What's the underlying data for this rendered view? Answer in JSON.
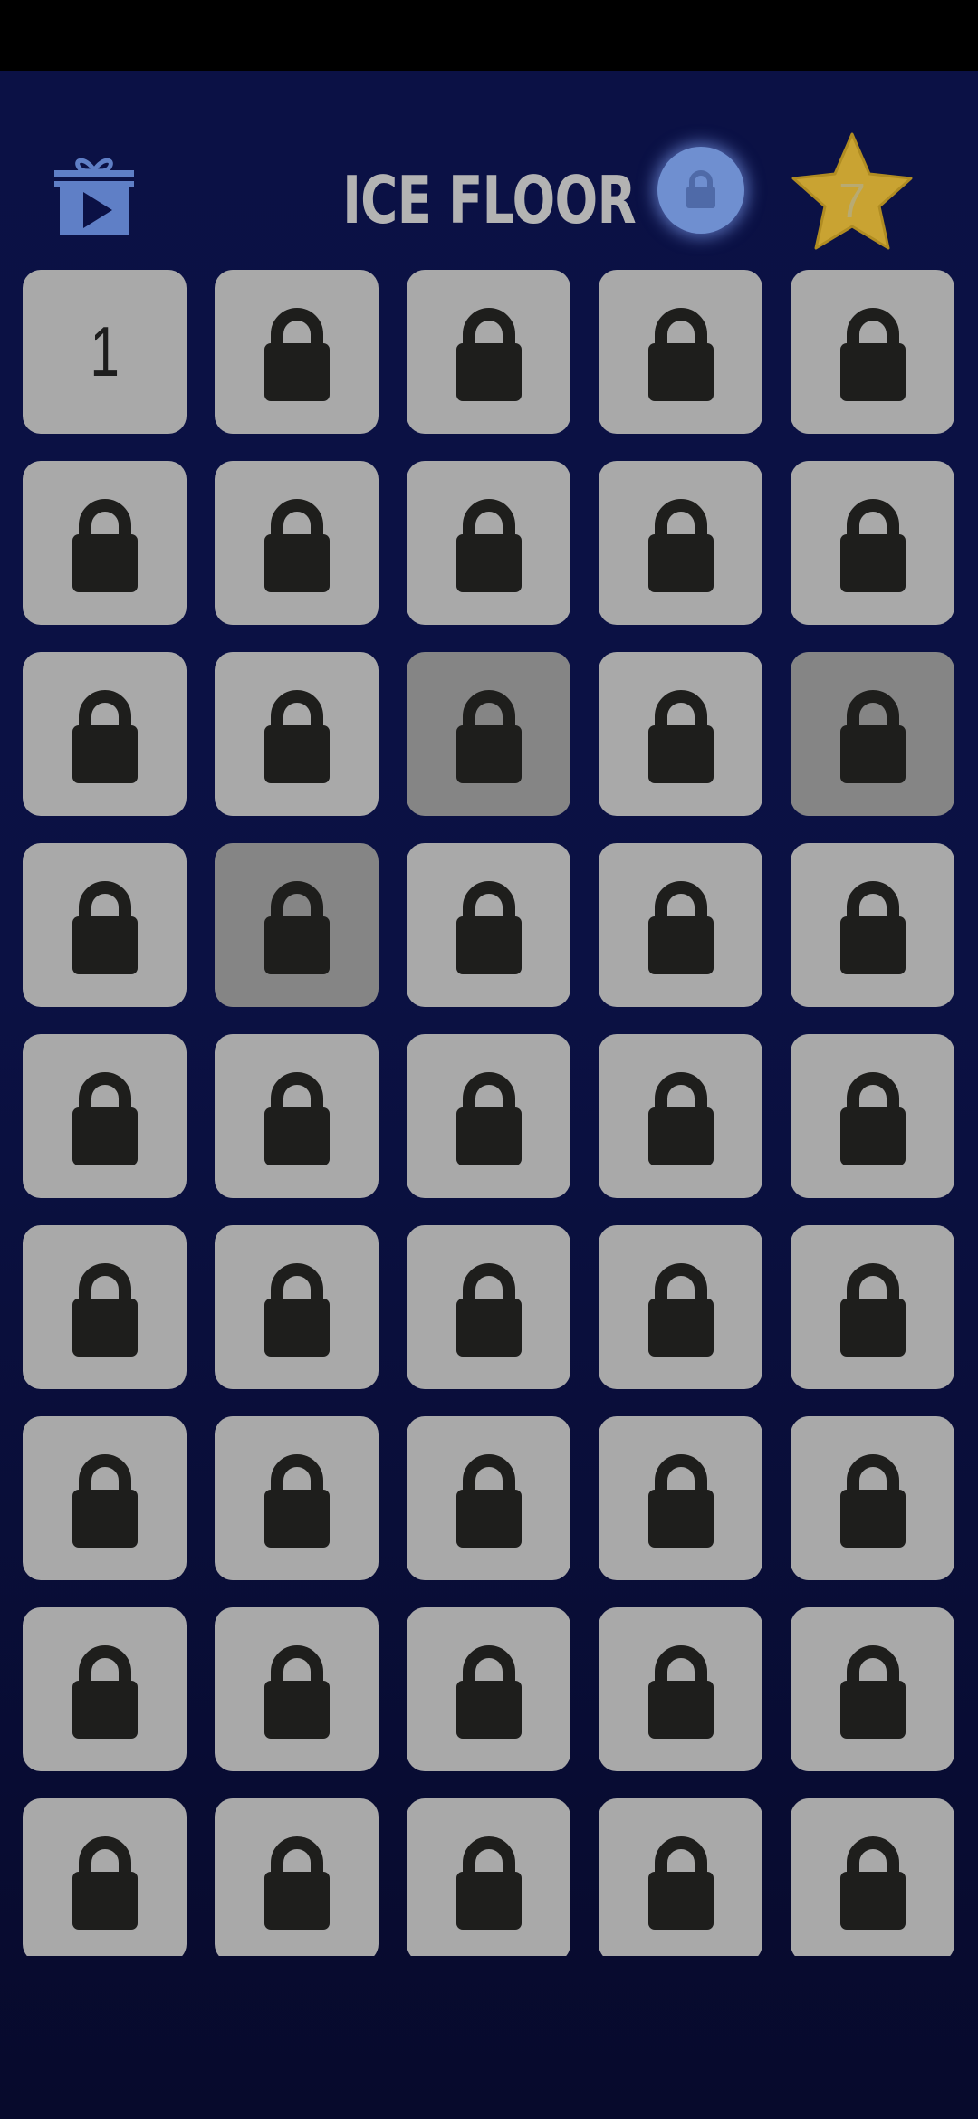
{
  "header": {
    "title": "ICE FLOOR",
    "star_count": "7",
    "gift_icon": "gift-video-icon",
    "lock_icon": "lock-icon",
    "star_icon": "star-icon"
  },
  "colors": {
    "background": "#0b1145",
    "tile": "#a9a9a9",
    "tile_dim": "#858585",
    "lock": "#1e1e1c",
    "accent_blue": "#6f8fd0",
    "star_gold": "#c9a332"
  },
  "levels": [
    {
      "label": "1",
      "state": "unlocked"
    },
    {
      "state": "locked"
    },
    {
      "state": "locked"
    },
    {
      "state": "locked"
    },
    {
      "state": "locked"
    },
    {
      "state": "locked"
    },
    {
      "state": "locked"
    },
    {
      "state": "locked"
    },
    {
      "state": "locked"
    },
    {
      "state": "locked"
    },
    {
      "state": "locked"
    },
    {
      "state": "locked"
    },
    {
      "state": "locked",
      "dim": true
    },
    {
      "state": "locked"
    },
    {
      "state": "locked",
      "dim": true
    },
    {
      "state": "locked"
    },
    {
      "state": "locked",
      "dim": true
    },
    {
      "state": "locked"
    },
    {
      "state": "locked"
    },
    {
      "state": "locked"
    },
    {
      "state": "locked"
    },
    {
      "state": "locked"
    },
    {
      "state": "locked"
    },
    {
      "state": "locked"
    },
    {
      "state": "locked"
    },
    {
      "state": "locked"
    },
    {
      "state": "locked"
    },
    {
      "state": "locked"
    },
    {
      "state": "locked"
    },
    {
      "state": "locked"
    },
    {
      "state": "locked"
    },
    {
      "state": "locked"
    },
    {
      "state": "locked"
    },
    {
      "state": "locked"
    },
    {
      "state": "locked"
    },
    {
      "state": "locked"
    },
    {
      "state": "locked"
    },
    {
      "state": "locked"
    },
    {
      "state": "locked"
    },
    {
      "state": "locked"
    },
    {
      "state": "locked"
    },
    {
      "state": "locked"
    },
    {
      "state": "locked"
    },
    {
      "state": "locked"
    },
    {
      "state": "locked"
    }
  ]
}
